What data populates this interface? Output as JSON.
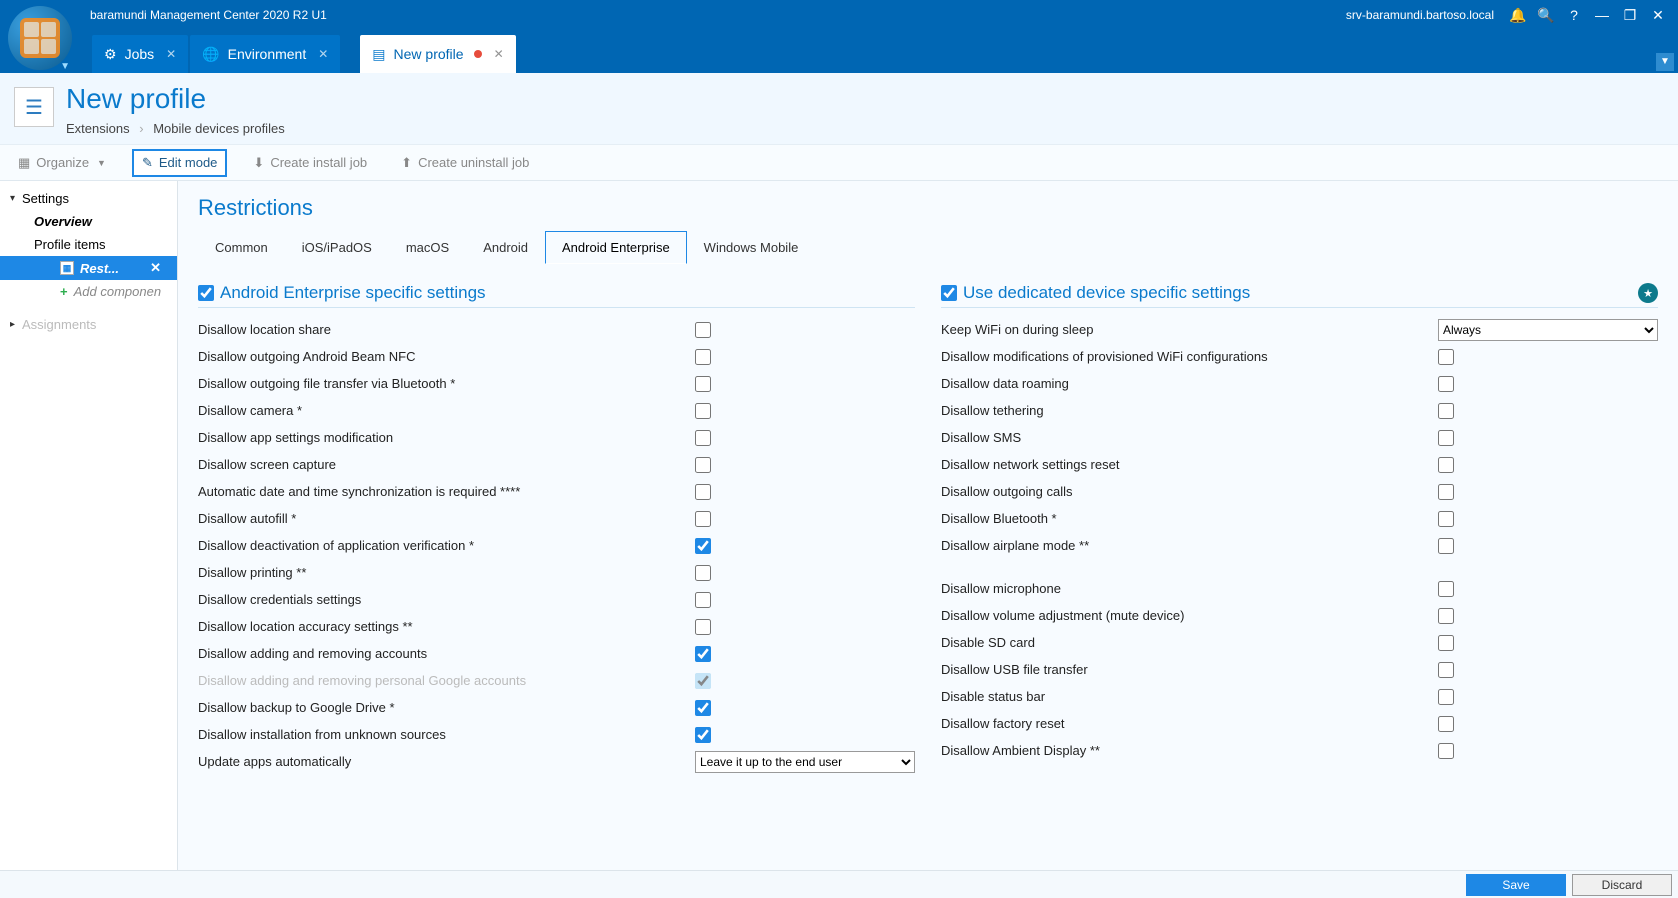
{
  "titlebar": {
    "app": "baramundi Management Center 2020 R2 U1",
    "host": "srv-baramundi.bartoso.local"
  },
  "tabs": [
    {
      "label": "Jobs",
      "icon": "⚙",
      "active": false
    },
    {
      "label": "Environment",
      "icon": "🌐",
      "active": false
    },
    {
      "label": "New profile",
      "icon": "▢",
      "active": true,
      "dirty": true
    }
  ],
  "page": {
    "title": "New profile",
    "breadcrumb": [
      "Extensions",
      "Mobile devices profiles"
    ]
  },
  "toolbar": {
    "organize": "Organize",
    "editmode": "Edit mode",
    "create_install": "Create install job",
    "create_uninstall": "Create uninstall job"
  },
  "sidebar": {
    "settings": "Settings",
    "overview": "Overview",
    "profile_items": "Profile items",
    "rest": "Rest...",
    "add_component": "Add componen",
    "assignments": "Assignments"
  },
  "content": {
    "heading": "Restrictions",
    "subtabs": [
      "Common",
      "iOS/iPadOS",
      "macOS",
      "Android",
      "Android Enterprise",
      "Windows Mobile"
    ],
    "active_subtab": "Android Enterprise",
    "left": {
      "title": "Android Enterprise specific settings",
      "checked": true,
      "rows": [
        {
          "label": "Disallow location share",
          "type": "check",
          "value": false
        },
        {
          "label": "Disallow outgoing Android Beam NFC",
          "type": "check",
          "value": false
        },
        {
          "label": "Disallow outgoing file transfer via Bluetooth *",
          "type": "check",
          "value": false
        },
        {
          "label": "Disallow camera *",
          "type": "check",
          "value": false
        },
        {
          "label": "Disallow app settings modification",
          "type": "check",
          "value": false
        },
        {
          "label": "Disallow screen capture",
          "type": "check",
          "value": false
        },
        {
          "label": "Automatic date and time synchronization is required ****",
          "type": "check",
          "value": false
        },
        {
          "label": "Disallow autofill *",
          "type": "check",
          "value": false
        },
        {
          "label": "Disallow deactivation of application verification *",
          "type": "check",
          "value": true
        },
        {
          "label": "Disallow printing **",
          "type": "check",
          "value": false
        },
        {
          "label": "Disallow credentials settings",
          "type": "check",
          "value": false
        },
        {
          "label": "Disallow location accuracy settings **",
          "type": "check",
          "value": false
        },
        {
          "label": "Disallow adding and removing accounts",
          "type": "check",
          "value": true
        },
        {
          "label": "Disallow adding and removing personal Google accounts",
          "type": "check",
          "value": true,
          "disabled": true
        },
        {
          "label": "Disallow backup to Google Drive *",
          "type": "check",
          "value": true
        },
        {
          "label": "Disallow installation from unknown sources",
          "type": "check",
          "value": true
        },
        {
          "label": "Update apps automatically",
          "type": "select",
          "value": "Leave it up to the end user"
        }
      ]
    },
    "right": {
      "title": "Use dedicated device specific settings",
      "checked": true,
      "has_star": true,
      "rows": [
        {
          "label": "Keep WiFi on during sleep",
          "type": "select",
          "value": "Always"
        },
        {
          "label": "Disallow modifications of provisioned WiFi configurations",
          "type": "check",
          "value": false
        },
        {
          "label": "Disallow data roaming",
          "type": "check",
          "value": false
        },
        {
          "label": "Disallow tethering",
          "type": "check",
          "value": false
        },
        {
          "label": "Disallow SMS",
          "type": "check",
          "value": false
        },
        {
          "label": "Disallow network settings reset",
          "type": "check",
          "value": false
        },
        {
          "label": "Disallow outgoing calls",
          "type": "check",
          "value": false
        },
        {
          "label": "Disallow Bluetooth *",
          "type": "check",
          "value": false
        },
        {
          "label": "Disallow airplane mode **",
          "type": "check",
          "value": false
        },
        {
          "type": "spacer"
        },
        {
          "label": "Disallow microphone",
          "type": "check",
          "value": false
        },
        {
          "label": "Disallow volume adjustment (mute device)",
          "type": "check",
          "value": false
        },
        {
          "label": "Disable SD card",
          "type": "check",
          "value": false
        },
        {
          "label": "Disallow USB file transfer",
          "type": "check",
          "value": false
        },
        {
          "label": "Disable status bar",
          "type": "check",
          "value": false
        },
        {
          "label": "Disallow factory reset",
          "type": "check",
          "value": false
        },
        {
          "label": "Disallow Ambient Display **",
          "type": "check",
          "value": false
        }
      ]
    }
  },
  "footer": {
    "save": "Save",
    "discard": "Discard"
  }
}
